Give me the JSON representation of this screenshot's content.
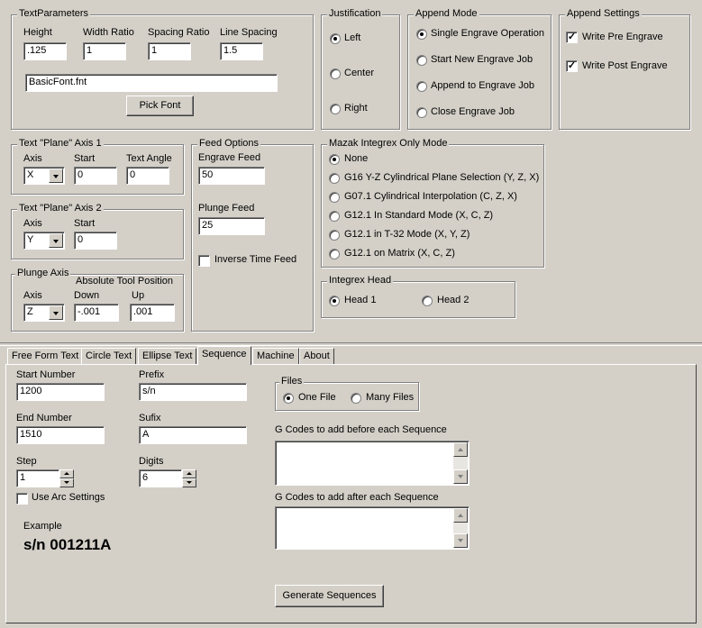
{
  "text_parameters": {
    "title": "TextParameters",
    "height_label": "Height",
    "height_value": ".125",
    "width_ratio_label": "Width Ratio",
    "width_ratio_value": "1",
    "spacing_ratio_label": "Spacing Ratio",
    "spacing_ratio_value": "1",
    "line_spacing_label": "Line Spacing",
    "line_spacing_value": "1.5",
    "font_value": "BasicFont.fnt",
    "pick_font_label": "Pick Font"
  },
  "justification": {
    "title": "Justification",
    "options": [
      "Left",
      "Center",
      "Right"
    ],
    "selected": "Left"
  },
  "append_mode": {
    "title": "Append Mode",
    "options": [
      "Single Engrave Operation",
      "Start New Engrave Job",
      "Append to Engrave Job",
      "Close Engrave Job"
    ],
    "selected": "Single Engrave Operation"
  },
  "append_settings": {
    "title": "Append Settings",
    "write_pre_label": "Write Pre Engrave",
    "write_pre_checked": true,
    "write_post_label": "Write Post Engrave",
    "write_post_checked": true
  },
  "axis1": {
    "title": "Text \"Plane\" Axis 1",
    "axis_label": "Axis",
    "axis_value": "X",
    "start_label": "Start",
    "start_value": "0",
    "angle_label": "Text Angle",
    "angle_value": "0"
  },
  "axis2": {
    "title": "Text \"Plane\" Axis 2",
    "axis_label": "Axis",
    "axis_value": "Y",
    "start_label": "Start",
    "start_value": "0"
  },
  "plunge_axis": {
    "title": "Plunge Axis",
    "abs_label": "Absolute Tool Position",
    "axis_label": "Axis",
    "axis_value": "Z",
    "down_label": "Down",
    "down_value": "-.001",
    "up_label": "Up",
    "up_value": ".001"
  },
  "feed_options": {
    "title": "Feed Options",
    "engrave_label": "Engrave Feed",
    "engrave_value": "50",
    "plunge_label": "Plunge Feed",
    "plunge_value": "25",
    "inverse_label": "Inverse Time Feed",
    "inverse_checked": false
  },
  "mazak": {
    "title": "Mazak Integrex Only Mode",
    "options": [
      "None",
      "G16 Y-Z Cylindrical Plane Selection (Y, Z, X)",
      "G07.1 Cylindrical Interpolation (C, Z, X)",
      "G12.1 In Standard Mode (X, C, Z)",
      "G12.1 in T-32 Mode (X, Y, Z)",
      "G12.1 on Matrix (X, C, Z)"
    ],
    "selected": "None"
  },
  "integrex_head": {
    "title": "Integrex Head",
    "options": [
      "Head 1",
      "Head 2"
    ],
    "selected": "Head 1"
  },
  "tabs": [
    "Free Form Text",
    "Circle Text",
    "Ellipse Text",
    "Sequence",
    "Machine",
    "About"
  ],
  "active_tab": "Sequence",
  "sequence": {
    "start_label": "Start Number",
    "start_value": "1200",
    "end_label": "End Number",
    "end_value": "1510",
    "step_label": "Step",
    "step_value": "1",
    "prefix_label": "Prefix",
    "prefix_value": "s/n",
    "suffix_label": "Sufix",
    "suffix_value": "A",
    "digits_label": "Digits",
    "digits_value": "6",
    "use_arc_label": "Use Arc Settings",
    "use_arc_checked": false,
    "example_label": "Example",
    "example_value": "s/n 001211A",
    "files_title": "Files",
    "files_options": [
      "One File",
      "Many Files"
    ],
    "files_selected": "One File",
    "before_label": "G Codes to add before each Sequence",
    "after_label": "G Codes to add after each Sequence",
    "generate_label": "Generate Sequences"
  }
}
